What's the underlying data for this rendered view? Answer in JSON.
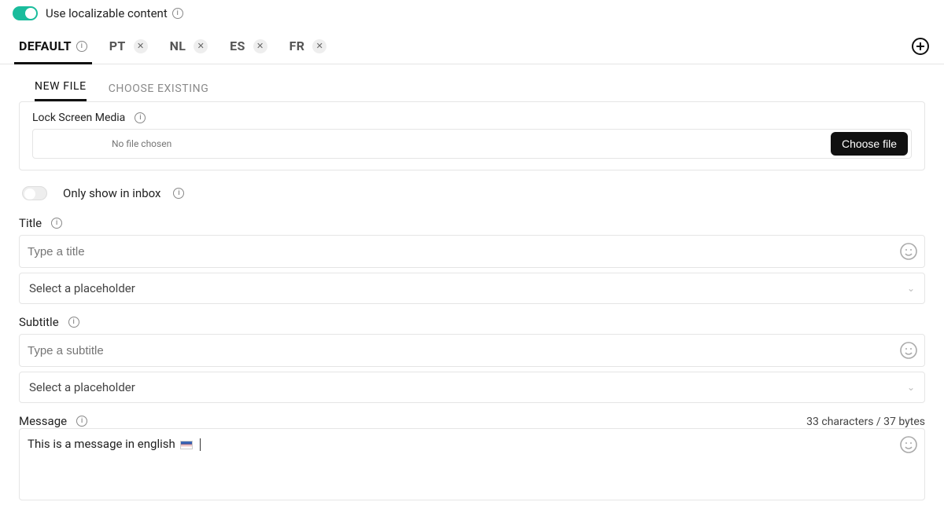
{
  "top": {
    "localizable_label": "Use localizable content"
  },
  "lang_tabs": {
    "default_label": "DEFAULT",
    "items": [
      {
        "code": "PT"
      },
      {
        "code": "NL"
      },
      {
        "code": "ES"
      },
      {
        "code": "FR"
      }
    ]
  },
  "subtabs": {
    "new_file": "NEW FILE",
    "choose_existing": "CHOOSE EXISTING"
  },
  "media": {
    "label": "Lock Screen Media",
    "no_file": "No file chosen",
    "choose": "Choose file"
  },
  "inbox": {
    "label": "Only show in inbox"
  },
  "title": {
    "label": "Title",
    "placeholder": "Type a title",
    "dropdown": "Select a placeholder"
  },
  "subtitle": {
    "label": "Subtitle",
    "placeholder": "Type a subtitle",
    "dropdown": "Select a placeholder"
  },
  "message": {
    "label": "Message",
    "value": "This is a message in english",
    "counts": "33 characters / 37 bytes"
  }
}
